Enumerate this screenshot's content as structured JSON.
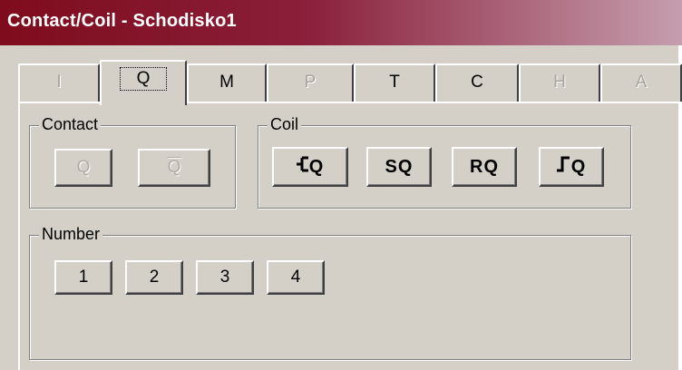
{
  "window": {
    "title": "Contact/Coil - Schodisko1"
  },
  "tabs": [
    {
      "label": "I",
      "enabled": false
    },
    {
      "label": "Q",
      "enabled": true,
      "active": true
    },
    {
      "label": "M",
      "enabled": true
    },
    {
      "label": "P",
      "enabled": false
    },
    {
      "label": "T",
      "enabled": true
    },
    {
      "label": "C",
      "enabled": true
    },
    {
      "label": "H",
      "enabled": false
    },
    {
      "label": "A",
      "enabled": false
    }
  ],
  "contact": {
    "label": "Contact",
    "normal_label": "Q",
    "inverted_label": "Q"
  },
  "coil": {
    "label": "Coil",
    "coil_label": "Q",
    "set_label": "SQ",
    "reset_label": "RQ",
    "pulse_label": "Q"
  },
  "number": {
    "label": "Number",
    "buttons": [
      "1",
      "2",
      "3",
      "4"
    ]
  },
  "colors": {
    "face": "#d4d0c8",
    "title_start": "#7e0c1c",
    "title_end": "#c59eae",
    "disabled_text": "#a8a49c"
  }
}
